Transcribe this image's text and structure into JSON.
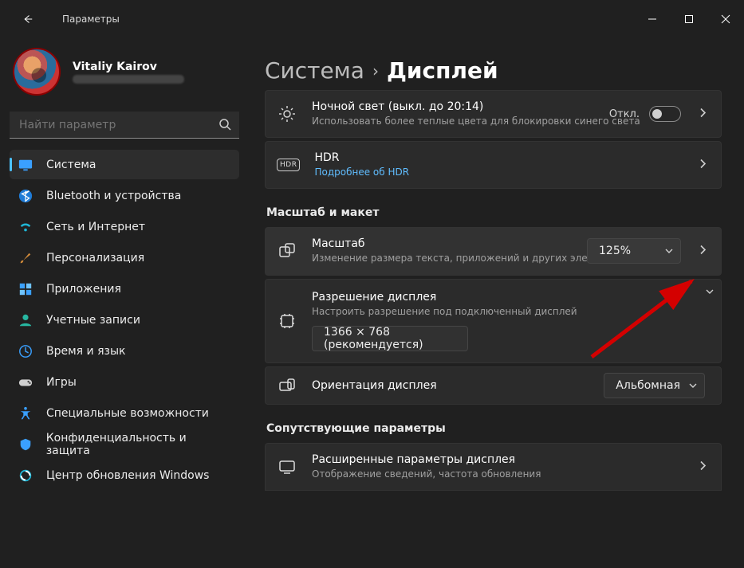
{
  "titlebar": {
    "title": "Параметры"
  },
  "profile": {
    "name": "Vitaliy Kairov"
  },
  "search": {
    "placeholder": "Найти параметр"
  },
  "nav": {
    "system": "Система",
    "bluetooth": "Bluetooth и устройства",
    "network": "Сеть и Интернет",
    "personalization": "Персонализация",
    "apps": "Приложения",
    "accounts": "Учетные записи",
    "time": "Время и язык",
    "games": "Игры",
    "accessibility": "Специальные возможности",
    "privacy": "Конфиденциальность и защита",
    "update": "Центр обновления Windows"
  },
  "breadcrumb": {
    "parent": "Система",
    "current": "Дисплей"
  },
  "cards": {
    "nightlight": {
      "title": "Ночной свет (выкл. до 20:14)",
      "sub": "Использовать более теплые цвета для блокировки синего света",
      "state": "Откл."
    },
    "hdr": {
      "title": "HDR",
      "sub": "Подробнее об HDR",
      "badge": "HDR"
    },
    "scale": {
      "title": "Масштаб",
      "sub": "Изменение размера текста, приложений и других элементов",
      "value": "125%"
    },
    "resolution": {
      "title": "Разрешение дисплея",
      "sub": "Настроить разрешение под подключенный дисплей",
      "value": "1366 × 768 (рекомендуется)"
    },
    "orientation": {
      "title": "Ориентация дисплея",
      "value": "Альбомная"
    },
    "advanced": {
      "title": "Расширенные параметры дисплея",
      "sub": "Отображение сведений, частота обновления"
    }
  },
  "sections": {
    "scale_layout": "Масштаб и макет",
    "related": "Сопутствующие параметры"
  }
}
